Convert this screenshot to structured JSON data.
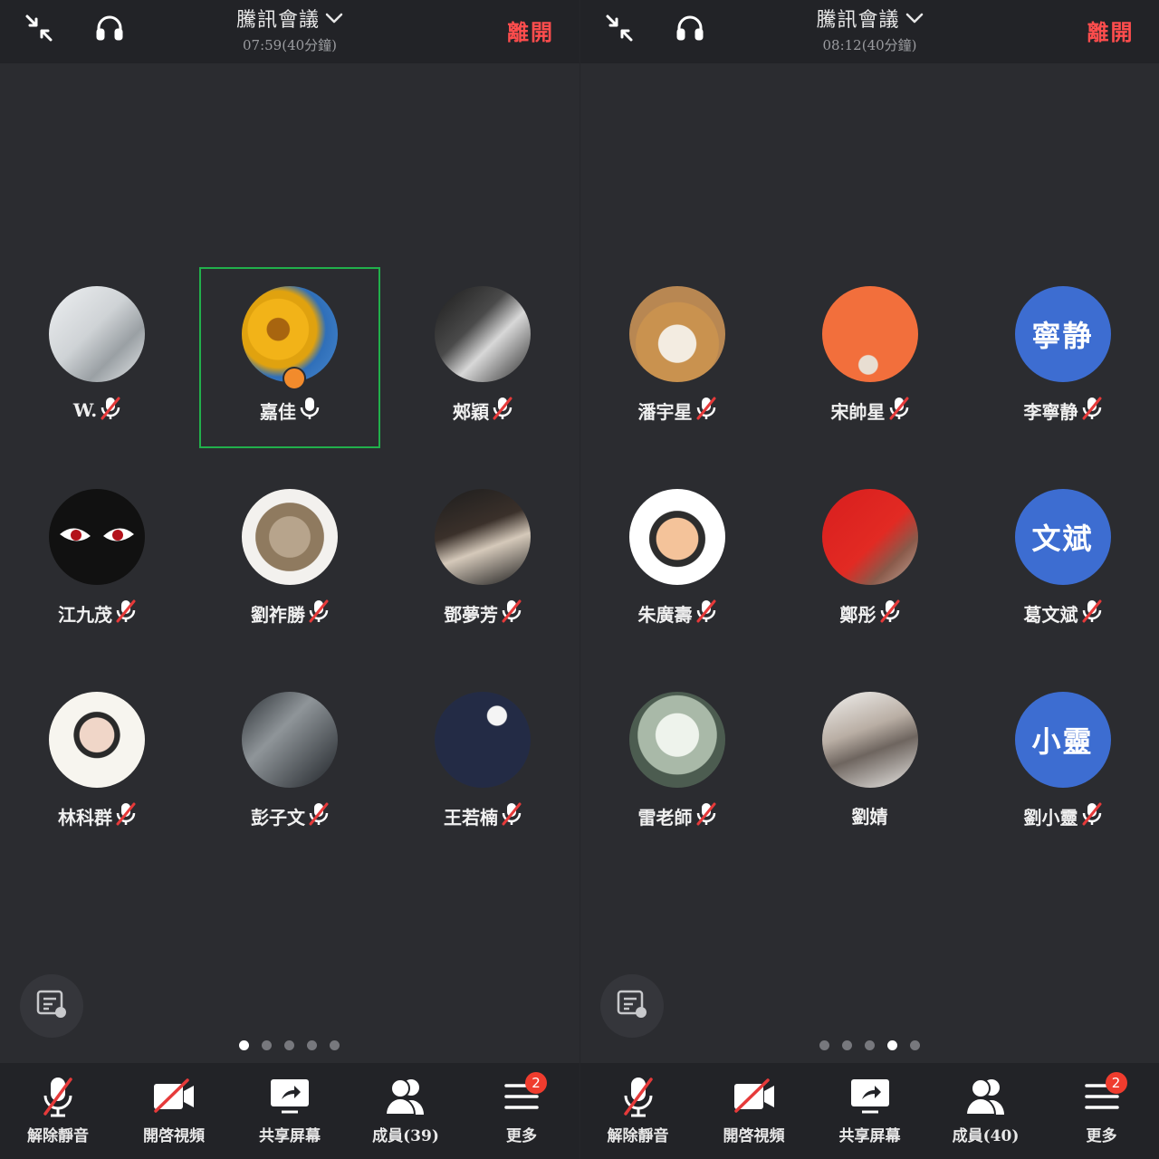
{
  "panels": [
    {
      "title": "騰訊會議",
      "subtitle": "07:59(40分鐘)",
      "leave_label": "離開",
      "active_page": 0,
      "participants": [
        {
          "name": "W.",
          "mic": "muted",
          "avatar": "photo-woman-flowers"
        },
        {
          "name": "嘉佳",
          "mic": "on",
          "avatar": "photo-sunflowers",
          "active": true,
          "host": true
        },
        {
          "name": "郟穎",
          "mic": "muted",
          "avatar": "photo-woman-bw"
        },
        {
          "name": "江九茂",
          "mic": "muted",
          "avatar": "photo-dark-face"
        },
        {
          "name": "劉祚勝",
          "mic": "muted",
          "avatar": "photo-cat"
        },
        {
          "name": "鄧夢芳",
          "mic": "muted",
          "avatar": "photo-girl-scarf"
        },
        {
          "name": "林科群",
          "mic": "muted",
          "avatar": "photo-child"
        },
        {
          "name": "彭子文",
          "mic": "muted",
          "avatar": "photo-man-arm"
        },
        {
          "name": "王若楠",
          "mic": "muted",
          "avatar": "photo-balloon"
        }
      ],
      "bottom": {
        "unmute": "解除靜音",
        "video": "開啓視頻",
        "share": "共享屏幕",
        "members": "成員(39)",
        "more": "更多",
        "more_badge": "2"
      }
    },
    {
      "title": "騰訊會議",
      "subtitle": "08:12(40分鐘)",
      "leave_label": "離開",
      "active_page": 3,
      "participants": [
        {
          "name": "潘宇星",
          "mic": "muted",
          "avatar": "photo-shiba"
        },
        {
          "name": "宋帥星",
          "mic": "muted",
          "avatar": "photo-orange-wall"
        },
        {
          "name": "李寧静",
          "mic": "muted",
          "avatar_text": "寧静"
        },
        {
          "name": "朱廣壽",
          "mic": "muted",
          "avatar": "photo-memoji"
        },
        {
          "name": "鄭彤",
          "mic": "muted",
          "avatar": "photo-flag"
        },
        {
          "name": "葛文斌",
          "mic": "muted",
          "avatar_text": "文斌"
        },
        {
          "name": "雷老師",
          "mic": "muted",
          "avatar": "photo-flowers-white"
        },
        {
          "name": "劉婧",
          "mic": "none",
          "avatar": "photo-hat"
        },
        {
          "name": "劉小靈",
          "mic": "muted",
          "avatar_text": "小靈"
        }
      ],
      "bottom": {
        "unmute": "解除靜音",
        "video": "開啓視頻",
        "share": "共享屏幕",
        "members": "成員(40)",
        "more": "更多",
        "more_badge": "2"
      }
    }
  ],
  "page_count": 5,
  "colors": {
    "active_border": "#21b04b",
    "leave": "#ff4d4d",
    "text_avatar": "#3d6dd1",
    "badge": "#f03c2e"
  }
}
